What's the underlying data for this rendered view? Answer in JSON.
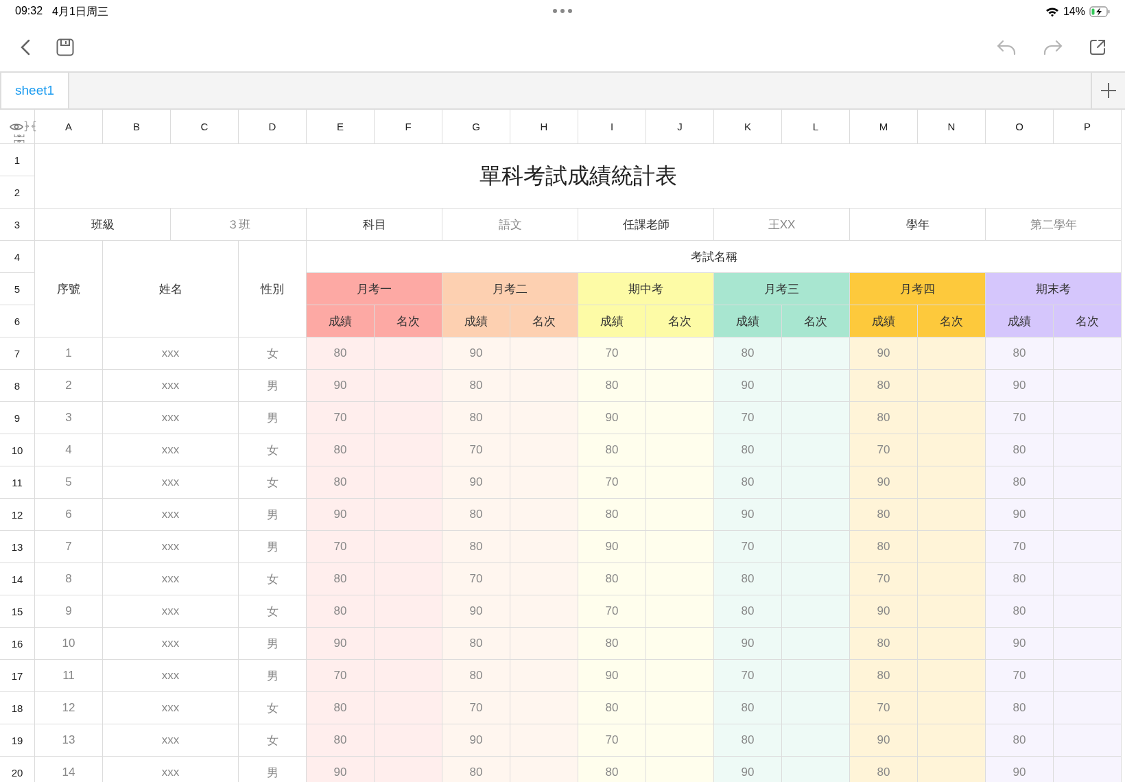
{
  "status_bar": {
    "time": "09:32",
    "date": "4月1日周三",
    "battery": "14%"
  },
  "toolbar": {
    "undo": {
      "disabled": true
    },
    "redo": {
      "disabled": true
    }
  },
  "sheet_tabs": [
    {
      "label": "sheet1",
      "selected": true
    }
  ],
  "column_headers": [
    "A",
    "B",
    "C",
    "D",
    "E",
    "F",
    "G",
    "H",
    "I",
    "J",
    "K",
    "L",
    "M",
    "N",
    "O",
    "P"
  ],
  "row_headers": [
    "1",
    "2",
    "3",
    "4",
    "5",
    "6",
    "7",
    "8",
    "9",
    "10",
    "11",
    "12",
    "13",
    "14",
    "15",
    "16",
    "17",
    "18",
    "19",
    "20"
  ],
  "table": {
    "title": "單科考試成績統計表",
    "info": [
      {
        "label": "班級",
        "value": "３班"
      },
      {
        "label": "科目",
        "value": "語文"
      },
      {
        "label": "任課老師",
        "value": "王XX"
      },
      {
        "label": "學年",
        "value": "第二學年"
      }
    ],
    "fixed_columns": [
      "序號",
      "姓名",
      "性別"
    ],
    "exam_group_label": "考試名稱",
    "exams": [
      {
        "name": "月考一",
        "color": "#fda9a4",
        "subcolumns": [
          "成績",
          "名次"
        ]
      },
      {
        "name": "月考二",
        "color": "#fdd0b1",
        "subcolumns": [
          "成績",
          "名次"
        ]
      },
      {
        "name": "期中考",
        "color": "#fdfba6",
        "subcolumns": [
          "成績",
          "名次"
        ]
      },
      {
        "name": "月考三",
        "color": "#a8e6d0",
        "subcolumns": [
          "成績",
          "名次"
        ]
      },
      {
        "name": "月考四",
        "color": "#fdc93c",
        "subcolumns": [
          "成績",
          "名次"
        ]
      },
      {
        "name": "期末考",
        "color": "#d5c6fc",
        "subcolumns": [
          "成績",
          "名次"
        ]
      }
    ],
    "rows": [
      {
        "no": "1",
        "name": "xxx",
        "gender": "女",
        "scores": [
          "80",
          "90",
          "70",
          "80",
          "90",
          "80"
        ]
      },
      {
        "no": "2",
        "name": "xxx",
        "gender": "男",
        "scores": [
          "90",
          "80",
          "80",
          "90",
          "80",
          "90"
        ]
      },
      {
        "no": "3",
        "name": "xxx",
        "gender": "男",
        "scores": [
          "70",
          "80",
          "90",
          "70",
          "80",
          "70"
        ]
      },
      {
        "no": "4",
        "name": "xxx",
        "gender": "女",
        "scores": [
          "80",
          "70",
          "80",
          "80",
          "70",
          "80"
        ]
      },
      {
        "no": "5",
        "name": "xxx",
        "gender": "女",
        "scores": [
          "80",
          "90",
          "70",
          "80",
          "90",
          "80"
        ]
      },
      {
        "no": "6",
        "name": "xxx",
        "gender": "男",
        "scores": [
          "90",
          "80",
          "80",
          "90",
          "80",
          "90"
        ]
      },
      {
        "no": "7",
        "name": "xxx",
        "gender": "男",
        "scores": [
          "70",
          "80",
          "90",
          "70",
          "80",
          "70"
        ]
      },
      {
        "no": "8",
        "name": "xxx",
        "gender": "女",
        "scores": [
          "80",
          "70",
          "80",
          "80",
          "70",
          "80"
        ]
      },
      {
        "no": "9",
        "name": "xxx",
        "gender": "女",
        "scores": [
          "80",
          "90",
          "70",
          "80",
          "90",
          "80"
        ]
      },
      {
        "no": "10",
        "name": "xxx",
        "gender": "男",
        "scores": [
          "90",
          "80",
          "80",
          "90",
          "80",
          "90"
        ]
      },
      {
        "no": "11",
        "name": "xxx",
        "gender": "男",
        "scores": [
          "70",
          "80",
          "90",
          "70",
          "80",
          "70"
        ]
      },
      {
        "no": "12",
        "name": "xxx",
        "gender": "女",
        "scores": [
          "80",
          "70",
          "80",
          "80",
          "70",
          "80"
        ]
      },
      {
        "no": "13",
        "name": "xxx",
        "gender": "女",
        "scores": [
          "80",
          "90",
          "70",
          "80",
          "90",
          "80"
        ]
      },
      {
        "no": "14",
        "name": "xxx",
        "gender": "男",
        "scores": [
          "90",
          "80",
          "80",
          "90",
          "80",
          "90"
        ]
      }
    ]
  }
}
